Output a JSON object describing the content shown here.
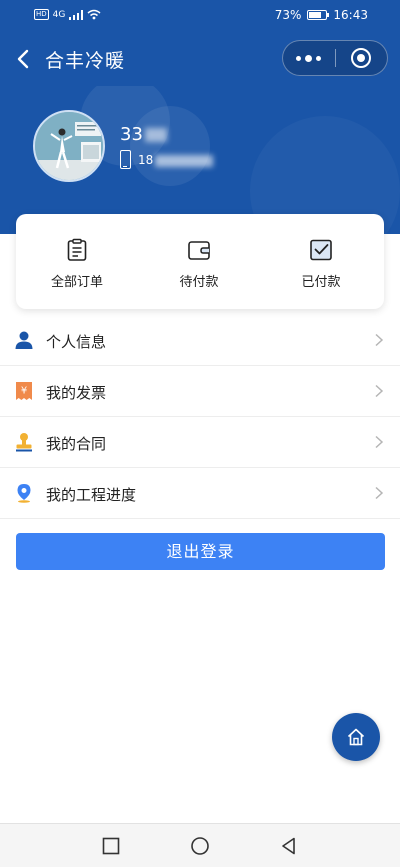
{
  "status_bar": {
    "network": "4G",
    "hd": "HD",
    "battery": "73%",
    "battery_level": 0.73,
    "time": "16:43"
  },
  "nav": {
    "title": "合丰冷暖",
    "back_icon": "chevron-left-icon",
    "more_icon": "more-dots-icon",
    "close_icon": "target-circle-icon"
  },
  "profile": {
    "name_visible": "33",
    "phone_visible": "18"
  },
  "orders": [
    {
      "label": "全部订单",
      "icon": "clipboard-icon"
    },
    {
      "label": "待付款",
      "icon": "wallet-icon"
    },
    {
      "label": "已付款",
      "icon": "checkbox-icon"
    }
  ],
  "menu": [
    {
      "label": "个人信息",
      "icon": "person-icon",
      "color": "#1a55a8"
    },
    {
      "label": "我的发票",
      "icon": "invoice-icon",
      "color": "#f08a4b"
    },
    {
      "label": "我的合同",
      "icon": "stamp-icon",
      "color": "#f2b132"
    },
    {
      "label": "我的工程进度",
      "icon": "location-pin-icon",
      "color": "#3d82f4"
    }
  ],
  "logout_label": "退出登录",
  "colors": {
    "brand": "#1a55a8",
    "button": "#3d82f4"
  }
}
